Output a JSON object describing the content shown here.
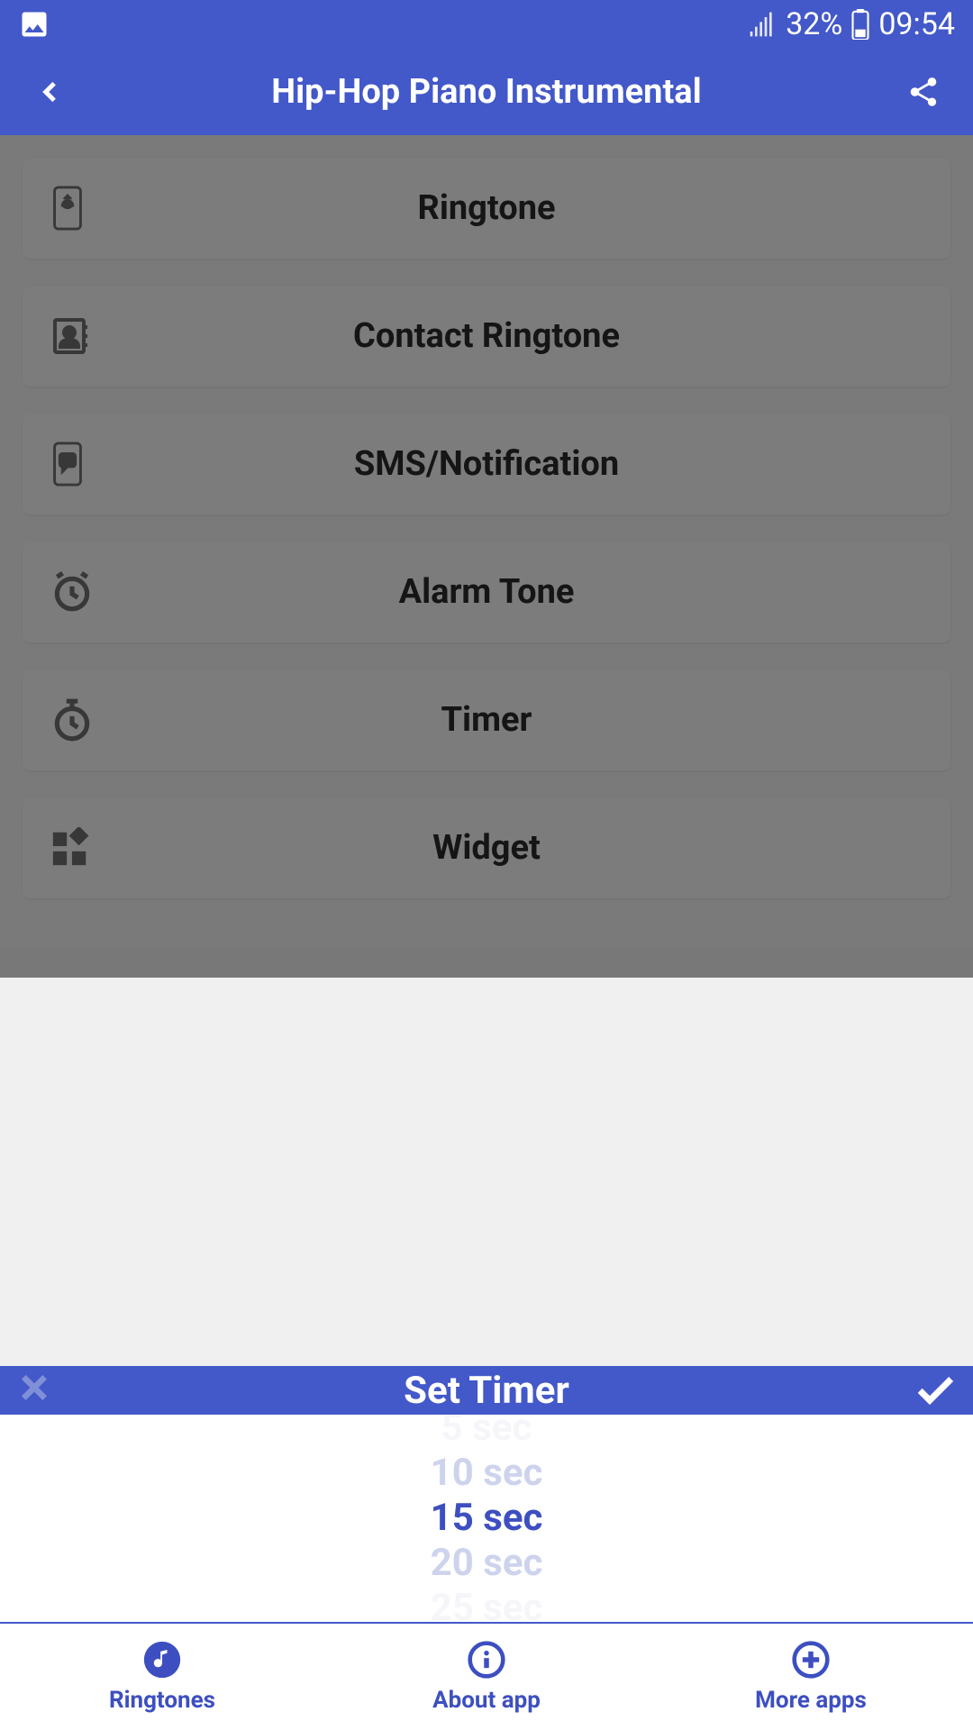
{
  "status_bar": {
    "battery_percent": "32%",
    "time": "09:54"
  },
  "header": {
    "title": "Hip-Hop Piano Instrumental"
  },
  "options": [
    {
      "label": "Ringtone",
      "icon": "phone-ringtone"
    },
    {
      "label": "Contact Ringtone",
      "icon": "contact"
    },
    {
      "label": "SMS/Notification",
      "icon": "sms"
    },
    {
      "label": "Alarm Tone",
      "icon": "alarm"
    },
    {
      "label": "Timer",
      "icon": "timer"
    },
    {
      "label": "Widget",
      "icon": "widget"
    }
  ],
  "timer_sheet": {
    "title": "Set Timer",
    "options": [
      "5 sec",
      "10 sec",
      "15 sec",
      "20 sec",
      "25 sec"
    ],
    "selected": "15 sec"
  },
  "bottom_nav": {
    "items": [
      {
        "label": "Ringtones",
        "icon": "music-note"
      },
      {
        "label": "About app",
        "icon": "info"
      },
      {
        "label": "More apps",
        "icon": "plus"
      }
    ]
  }
}
